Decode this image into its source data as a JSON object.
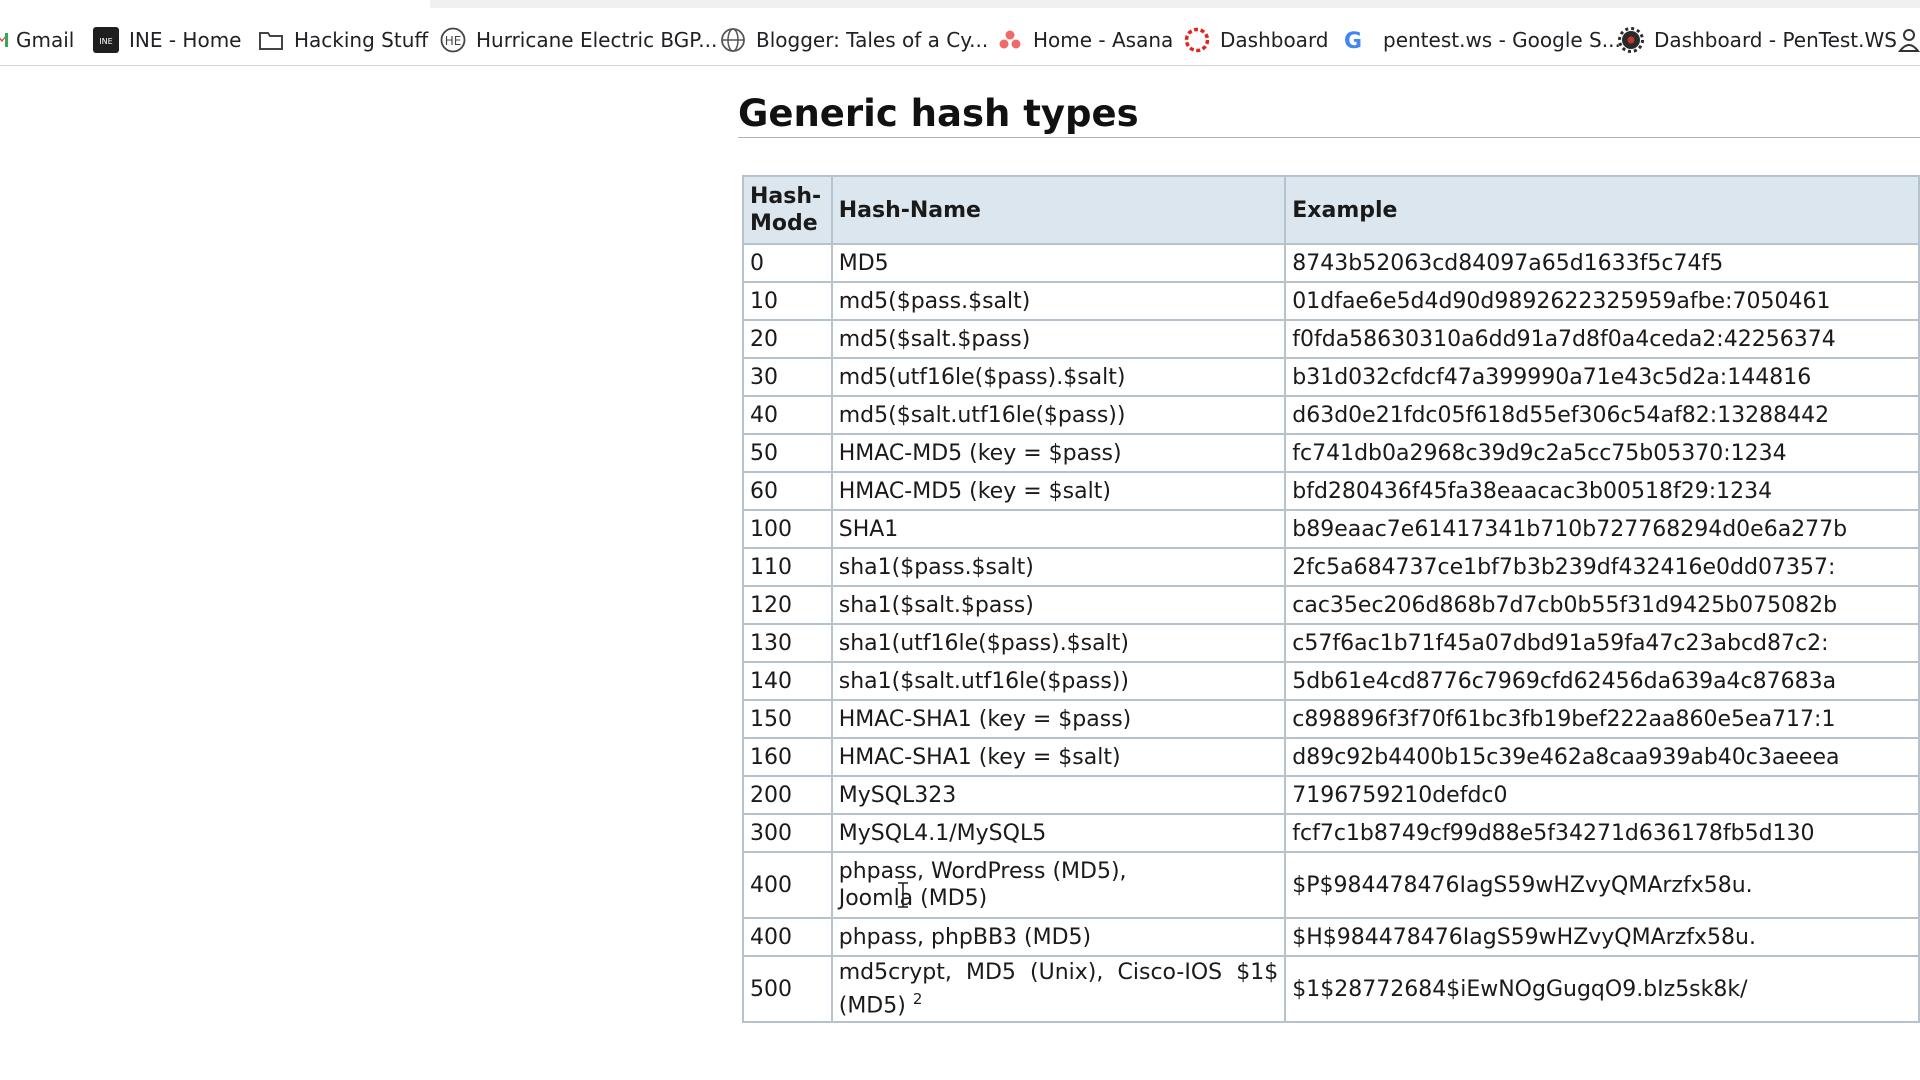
{
  "bookmarks": [
    {
      "label": "Gmail",
      "icon": "gmail-icon"
    },
    {
      "label": "INE - Home",
      "icon": "ine-icon"
    },
    {
      "label": "Hacking Stuff",
      "icon": "folder-icon"
    },
    {
      "label": "Hurricane Electric BGP...",
      "icon": "he-icon"
    },
    {
      "label": "Blogger: Tales of a Cy...",
      "icon": "globe-icon"
    },
    {
      "label": "Home - Asana",
      "icon": "asana-icon"
    },
    {
      "label": "Dashboard",
      "icon": "dashboard-icon"
    },
    {
      "label": "pentest.ws - Google S...",
      "icon": "google-icon"
    },
    {
      "label": "Dashboard - PenTest.WS",
      "icon": "pentestws-icon"
    }
  ],
  "page": {
    "title": "Generic hash types"
  },
  "table": {
    "headers": [
      "Hash-Mode",
      "Hash-Name",
      "Example"
    ],
    "rows": [
      {
        "mode": "0",
        "name": "MD5",
        "example": "8743b52063cd84097a65d1633f5c74f5"
      },
      {
        "mode": "10",
        "name": "md5($pass.$salt)",
        "example": "01dfae6e5d4d90d9892622325959afbe:7050461"
      },
      {
        "mode": "20",
        "name": "md5($salt.$pass)",
        "example": "f0fda58630310a6dd91a7d8f0a4ceda2:42256374"
      },
      {
        "mode": "30",
        "name": "md5(utf16le($pass).$salt)",
        "example": "b31d032cfdcf47a399990a71e43c5d2a:144816"
      },
      {
        "mode": "40",
        "name": "md5($salt.utf16le($pass))",
        "example": "d63d0e21fdc05f618d55ef306c54af82:13288442"
      },
      {
        "mode": "50",
        "name": "HMAC-MD5 (key = $pass)",
        "example": "fc741db0a2968c39d9c2a5cc75b05370:1234"
      },
      {
        "mode": "60",
        "name": "HMAC-MD5 (key = $salt)",
        "example": "bfd280436f45fa38eaacac3b00518f29:1234"
      },
      {
        "mode": "100",
        "name": "SHA1",
        "example": "b89eaac7e61417341b710b727768294d0e6a277b"
      },
      {
        "mode": "110",
        "name": "sha1($pass.$salt)",
        "example": "2fc5a684737ce1bf7b3b239df432416e0dd07357:"
      },
      {
        "mode": "120",
        "name": "sha1($salt.$pass)",
        "example": "cac35ec206d868b7d7cb0b55f31d9425b075082b"
      },
      {
        "mode": "130",
        "name": "sha1(utf16le($pass).$salt)",
        "example": "c57f6ac1b71f45a07dbd91a59fa47c23abcd87c2:"
      },
      {
        "mode": "140",
        "name": "sha1($salt.utf16le($pass))",
        "example": "5db61e4cd8776c7969cfd62456da639a4c87683a"
      },
      {
        "mode": "150",
        "name": "HMAC-SHA1 (key = $pass)",
        "example": "c898896f3f70f61bc3fb19bef222aa860e5ea717:1"
      },
      {
        "mode": "160",
        "name": "HMAC-SHA1 (key = $salt)",
        "example": "d89c92b4400b15c39e462a8caa939ab40c3aeeea"
      },
      {
        "mode": "200",
        "name": "MySQL323",
        "example": "7196759210defdc0"
      },
      {
        "mode": "300",
        "name": "MySQL4.1/MySQL5",
        "example": "fcf7c1b8749cf99d88e5f34271d636178fb5d130"
      },
      {
        "mode": "400",
        "name_line1": "phpass, WordPress (MD5),",
        "name_line2": "Joomla (MD5)",
        "example": "$P$984478476IagS59wHZvyQMArzfx58u."
      },
      {
        "mode": "400",
        "name": "phpass, phpBB3 (MD5)",
        "example": "$H$984478476IagS59wHZvyQMArzfx58u."
      },
      {
        "mode": "500",
        "name": "md5crypt, MD5 (Unix), Cisco-IOS $1$ (MD5)",
        "footnote": "2",
        "example": "$1$28772684$iEwNOgGugqO9.bIz5sk8k/"
      }
    ]
  }
}
